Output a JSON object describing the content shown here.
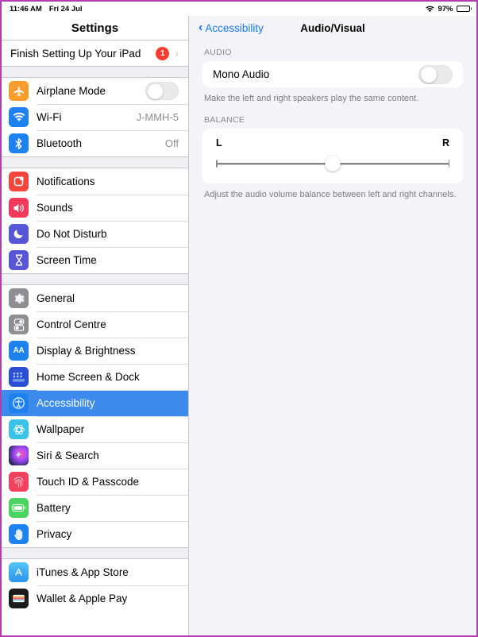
{
  "status_bar": {
    "time": "11:46 AM",
    "date": "Fri 24 Jul",
    "wifi_icon": "wifi-icon",
    "battery_percent": "97%",
    "battery_icon": "battery-icon"
  },
  "sidebar": {
    "title": "Settings",
    "setup_row": {
      "label": "Finish Setting Up Your iPad",
      "badge": "1",
      "chevron": "chevron-right-icon"
    },
    "groups": [
      {
        "items": [
          {
            "label": "Airplane Mode",
            "icon": "airplane-icon",
            "icon_color": "#f89c2c",
            "control": "toggle",
            "toggle_on": false
          },
          {
            "label": "Wi-Fi",
            "icon": "wifi-icon",
            "icon_color": "#1d82f0",
            "value": "J-MMH-5"
          },
          {
            "label": "Bluetooth",
            "icon": "bluetooth-icon",
            "icon_color": "#1d82f0",
            "value": "Off"
          }
        ]
      },
      {
        "items": [
          {
            "label": "Notifications",
            "icon": "notifications-icon",
            "icon_color": "#f4453c"
          },
          {
            "label": "Sounds",
            "icon": "sounds-icon",
            "icon_color": "#f23a5c"
          },
          {
            "label": "Do Not Disturb",
            "icon": "moon-icon",
            "icon_color": "#5756d6"
          },
          {
            "label": "Screen Time",
            "icon": "hourglass-icon",
            "icon_color": "#5756d6"
          }
        ]
      },
      {
        "items": [
          {
            "label": "General",
            "icon": "gear-icon",
            "icon_color": "#8e8e93"
          },
          {
            "label": "Control Centre",
            "icon": "control-centre-icon",
            "icon_color": "#8e8e93"
          },
          {
            "label": "Display & Brightness",
            "icon": "display-brightness-icon",
            "icon_color": "#1d82f0"
          },
          {
            "label": "Home Screen & Dock",
            "icon": "home-screen-dock-icon",
            "icon_color": "#2b4fd4"
          },
          {
            "label": "Accessibility",
            "icon": "accessibility-icon",
            "icon_color": "#1d82f0",
            "selected": true
          },
          {
            "label": "Wallpaper",
            "icon": "wallpaper-icon",
            "icon_color": "#3ac3e8"
          },
          {
            "label": "Siri & Search",
            "icon": "siri-icon",
            "icon_color": "#2b2b3d"
          },
          {
            "label": "Touch ID & Passcode",
            "icon": "touch-id-icon",
            "icon_color": "#f2415c"
          },
          {
            "label": "Battery",
            "icon": "battery-leaf-icon",
            "icon_color": "#4bd45f"
          },
          {
            "label": "Privacy",
            "icon": "privacy-hand-icon",
            "icon_color": "#1d82f0"
          }
        ]
      },
      {
        "items": [
          {
            "label": "iTunes & App Store",
            "icon": "app-store-icon",
            "icon_color": "#3aa8f4"
          },
          {
            "label": "Wallet & Apple Pay",
            "icon": "wallet-icon",
            "icon_color": "#1c1c1e"
          }
        ]
      }
    ]
  },
  "detail": {
    "back_label": "Accessibility",
    "back_icon": "chevron-left-icon",
    "title": "Audio/Visual",
    "sections": [
      {
        "header": "AUDIO",
        "row_label": "Mono Audio",
        "toggle_on": false,
        "footnote": "Make the left and right speakers play the same content."
      },
      {
        "header": "BALANCE",
        "left_label": "L",
        "right_label": "R",
        "slider_value": 50,
        "footnote": "Adjust the audio volume balance between left and right channels."
      }
    ]
  },
  "annotation": {
    "arrow_icon": "arrow-up-annotation",
    "color": "#b07ada"
  }
}
